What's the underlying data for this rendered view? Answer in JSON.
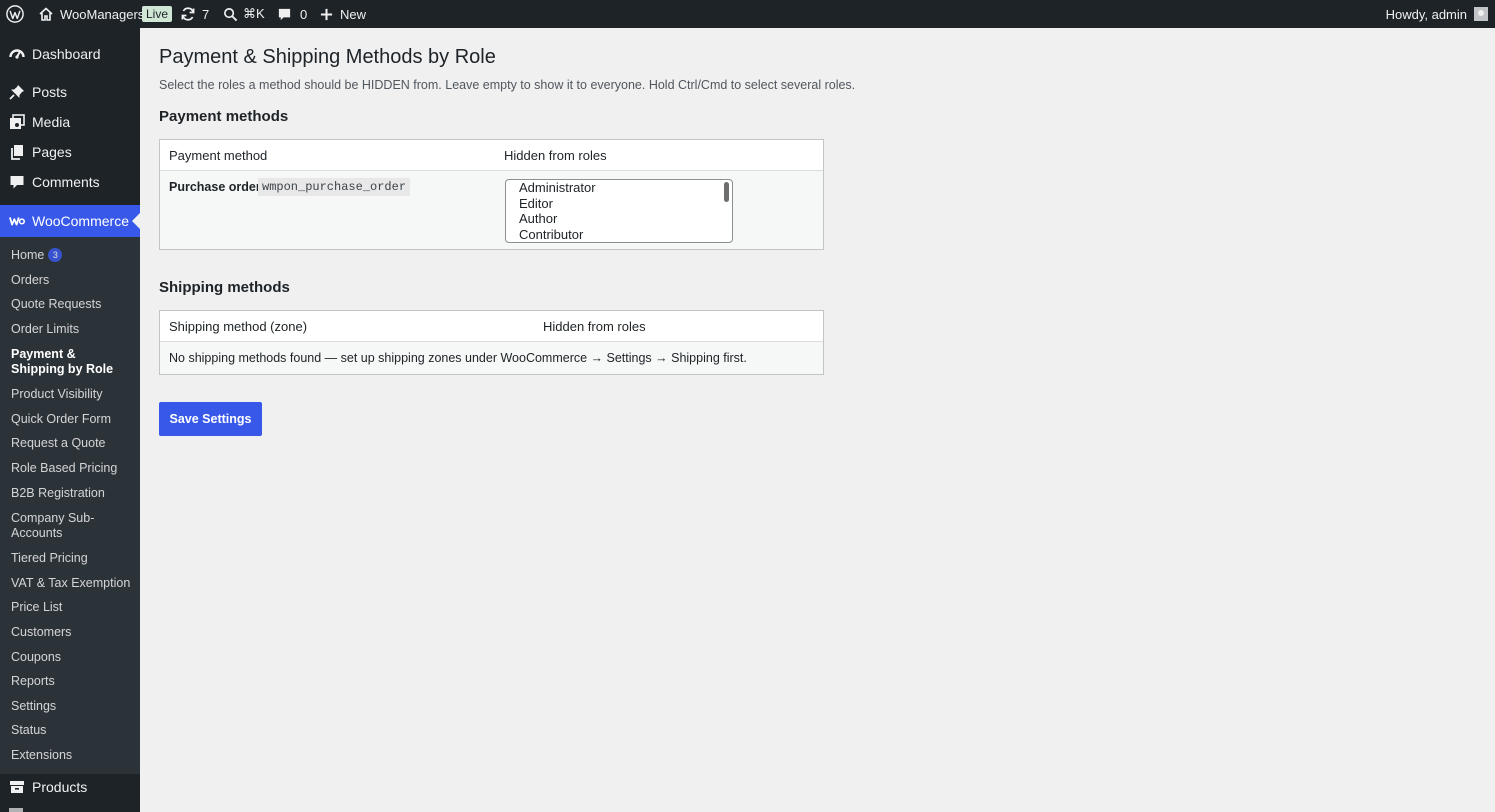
{
  "adminbar": {
    "site_name": "WooManagers",
    "live_label": "Live",
    "updates_count": "7",
    "search_shortcut": "⌘K",
    "comments_count": "0",
    "new_label": "New",
    "howdy": "Howdy, admin"
  },
  "sidebar": {
    "top_items": [
      {
        "label": "Dashboard",
        "icon": "dashboard-icon"
      },
      {
        "label": "Posts",
        "icon": "pin-icon"
      },
      {
        "label": "Media",
        "icon": "media-icon"
      },
      {
        "label": "Pages",
        "icon": "pages-icon"
      },
      {
        "label": "Comments",
        "icon": "comment-icon"
      },
      {
        "label": "WooCommerce",
        "icon": "woo-icon"
      }
    ],
    "submenu": [
      {
        "label": "Home",
        "badge": "3"
      },
      {
        "label": "Orders"
      },
      {
        "label": "Quote Requests"
      },
      {
        "label": "Order Limits"
      },
      {
        "label": "Payment & Shipping by Role"
      },
      {
        "label": "Product Visibility"
      },
      {
        "label": "Quick Order Form"
      },
      {
        "label": "Request a Quote"
      },
      {
        "label": "Role Based Pricing"
      },
      {
        "label": "B2B Registration"
      },
      {
        "label": "Company Sub-Accounts"
      },
      {
        "label": "Tiered Pricing"
      },
      {
        "label": "VAT & Tax Exemption"
      },
      {
        "label": "Price List"
      },
      {
        "label": "Customers"
      },
      {
        "label": "Coupons"
      },
      {
        "label": "Reports"
      },
      {
        "label": "Settings"
      },
      {
        "label": "Status"
      },
      {
        "label": "Extensions"
      }
    ],
    "bottom_items": [
      {
        "label": "Products",
        "icon": "archive-icon"
      }
    ]
  },
  "page": {
    "title": "Payment & Shipping Methods by Role",
    "description": "Select the roles a method should be HIDDEN from. Leave empty to show it to everyone. Hold Ctrl/Cmd to select several roles.",
    "payment": {
      "heading": "Payment methods",
      "col_method": "Payment method",
      "col_hidden": "Hidden from roles",
      "rows": [
        {
          "name": "Purchase order",
          "slug": "wmpon_purchase_order",
          "roles": [
            "Administrator",
            "Editor",
            "Author",
            "Contributor"
          ]
        }
      ]
    },
    "shipping": {
      "heading": "Shipping methods",
      "col_method": "Shipping method (zone)",
      "col_hidden": "Hidden from roles",
      "empty_message": "No shipping methods found — set up shipping zones under WooCommerce → Settings → Shipping first."
    },
    "save_label": "Save Settings"
  },
  "colors": {
    "accent": "#3858e9",
    "adminbar_bg": "#1d2327",
    "page_bg": "#f0f0f1"
  }
}
